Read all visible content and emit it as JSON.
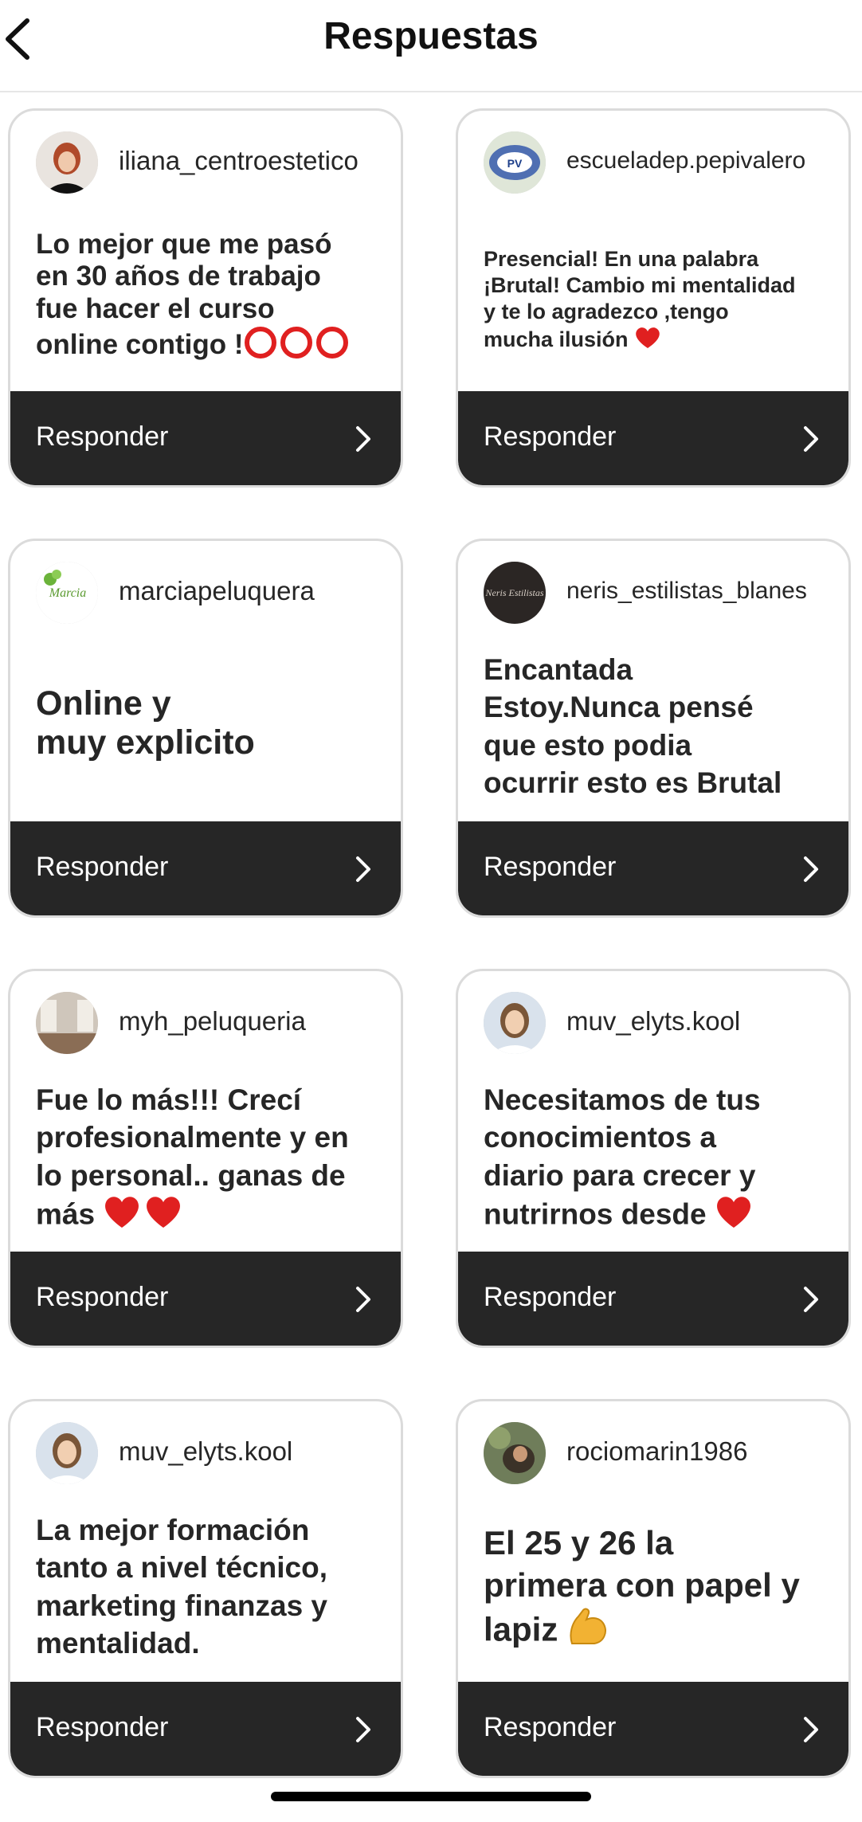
{
  "header": {
    "title": "Respuestas",
    "back_icon": "chevron-left-icon"
  },
  "reply_label": "Responder",
  "cards": [
    {
      "username": "iliana_centroestetico",
      "text": "Lo mejor que me pasó en 30 años de trabajo fue hacer el curso online contigo !⭕⭕⭕"
    },
    {
      "username": "escueladep.pepivalero",
      "text": "Presencial! En una palabra ¡Brutal! Cambio mi mentalidad y te lo agradezco ,tengo mucha ilusión ❤️"
    },
    {
      "username": "marciapeluquera",
      "text": "Online y muy explicito"
    },
    {
      "username": "neris_estilistas_blanes",
      "text": "Encantada Estoy.Nunca pensé que esto  podia ocurrir esto es Brutal"
    },
    {
      "username": "myh_peluqueria",
      "text": "Fue lo más!!! Crecí profesionalmente y en lo personal.. ganas de más ❤️❤️"
    },
    {
      "username": "muv_elyts.kool",
      "text": "Necesitamos de tus conocimientos a diario para crecer y nutrirnos desde ❤️"
    },
    {
      "username": "muv_elyts.kool",
      "text": "La mejor formación tanto a nivel técnico, marketing finanzas y mentalidad."
    },
    {
      "username": "rociomarin1986",
      "text": "El 25 y 26 la primera con papel y lapiz 💪"
    }
  ],
  "colors": {
    "footer": "#262626",
    "border": "#dbdbdb",
    "heart": "#e02020",
    "ring": "#e02020"
  }
}
